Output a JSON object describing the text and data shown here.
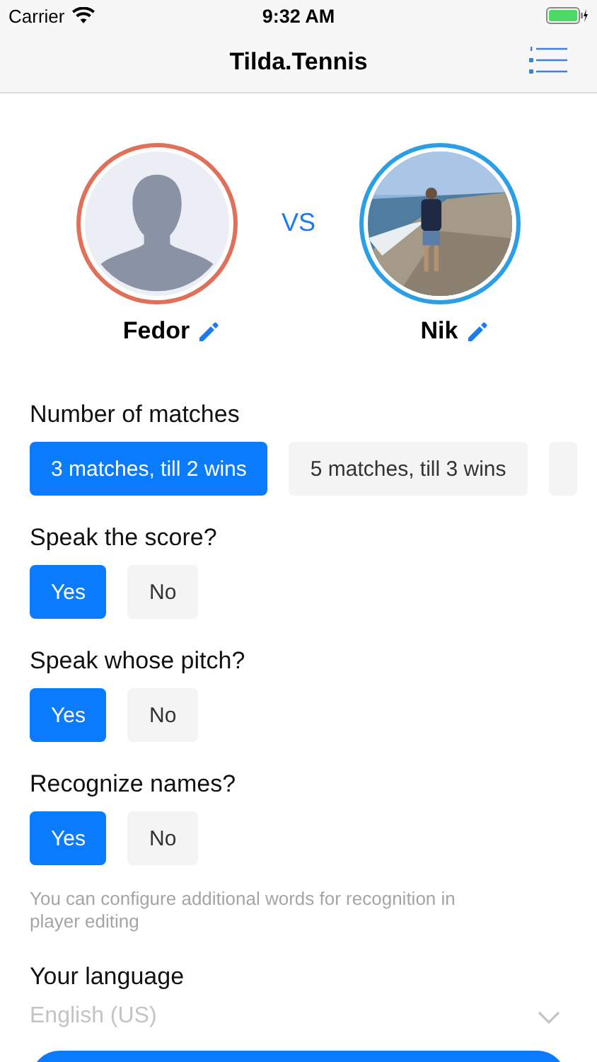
{
  "status_bar": {
    "carrier": "Carrier",
    "time": "9:32 AM"
  },
  "nav": {
    "title": "Tilda.Tennis"
  },
  "players": [
    {
      "name": "Fedor",
      "color": "#e0705a",
      "kind": "silhouette"
    },
    {
      "name": "Nik",
      "color": "#2a9fe8",
      "kind": "picture"
    }
  ],
  "versus": "VS",
  "questions": [
    {
      "label": "Number of matches",
      "options": [
        {
          "label": "3 matches, till 2 wins",
          "selected": true
        },
        {
          "label": "5 matches, till 3 wins",
          "selected": false
        }
      ]
    },
    {
      "label": "Speak the score?",
      "options": [
        {
          "label": "Yes",
          "selected": true
        },
        {
          "label": "No",
          "selected": false
        }
      ]
    },
    {
      "label": "Speak whose pitch?",
      "options": [
        {
          "label": "Yes",
          "selected": true
        },
        {
          "label": "No",
          "selected": false
        }
      ]
    },
    {
      "label": "Recognize names?",
      "options": [
        {
          "label": "Yes",
          "selected": true
        },
        {
          "label": "No",
          "selected": false
        }
      ],
      "hint": "You can configure additional words for recognition in player editing"
    }
  ],
  "language": {
    "label": "Your language",
    "value": "English (US)"
  }
}
